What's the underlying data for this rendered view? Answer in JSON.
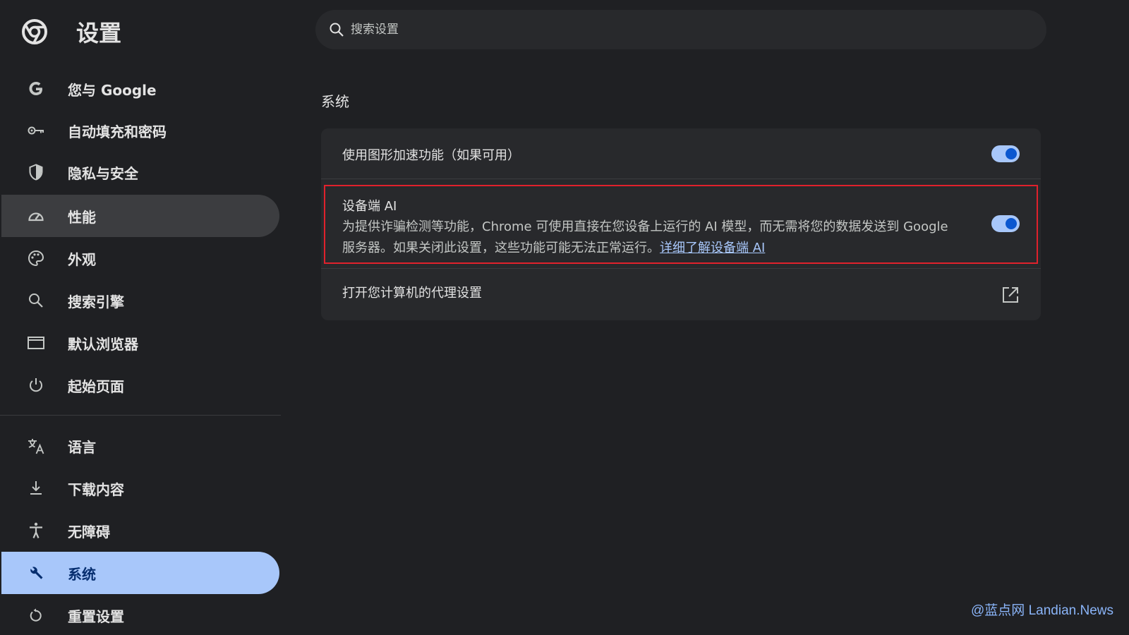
{
  "app": {
    "title": "设置"
  },
  "search": {
    "placeholder": "搜索设置"
  },
  "sidebar": {
    "items": [
      {
        "label": "您与 Google",
        "icon": "google-icon"
      },
      {
        "label": "自动填充和密码",
        "icon": "key-icon"
      },
      {
        "label": "隐私与安全",
        "icon": "shield-icon"
      },
      {
        "label": "性能",
        "icon": "speedometer-icon",
        "state": "hover"
      },
      {
        "label": "外观",
        "icon": "palette-icon"
      },
      {
        "label": "搜索引擎",
        "icon": "search-icon"
      },
      {
        "label": "默认浏览器",
        "icon": "browser-window-icon"
      },
      {
        "label": "起始页面",
        "icon": "power-icon"
      },
      {
        "label": "语言",
        "icon": "translate-icon"
      },
      {
        "label": "下载内容",
        "icon": "download-icon"
      },
      {
        "label": "无障碍",
        "icon": "accessibility-icon"
      },
      {
        "label": "系统",
        "icon": "wrench-icon",
        "state": "active"
      },
      {
        "label": "重置设置",
        "icon": "reset-icon"
      }
    ]
  },
  "main": {
    "section_title": "系统",
    "settings": [
      {
        "label": "使用图形加速功能（如果可用）",
        "enabled": true
      },
      {
        "label": "设备端 AI",
        "description": "为提供诈骗检测等功能，Chrome 可使用直接在您设备上运行的 AI 模型，而无需将您的数据发送到 Google 服务器。如果关闭此设置，这些功能可能无法正常运行。",
        "link_text": "详细了解设备端 AI",
        "enabled": true
      },
      {
        "label": "打开您计算机的代理设置",
        "icon": "open-external-icon"
      }
    ]
  },
  "watermark": "@蓝点网 Landian.News",
  "colors": {
    "background": "#1f2023",
    "card": "#28292c",
    "active_nav": "#a8c7fa",
    "toggle_on": "#a8c7fa",
    "highlight_border": "#e0212c"
  }
}
